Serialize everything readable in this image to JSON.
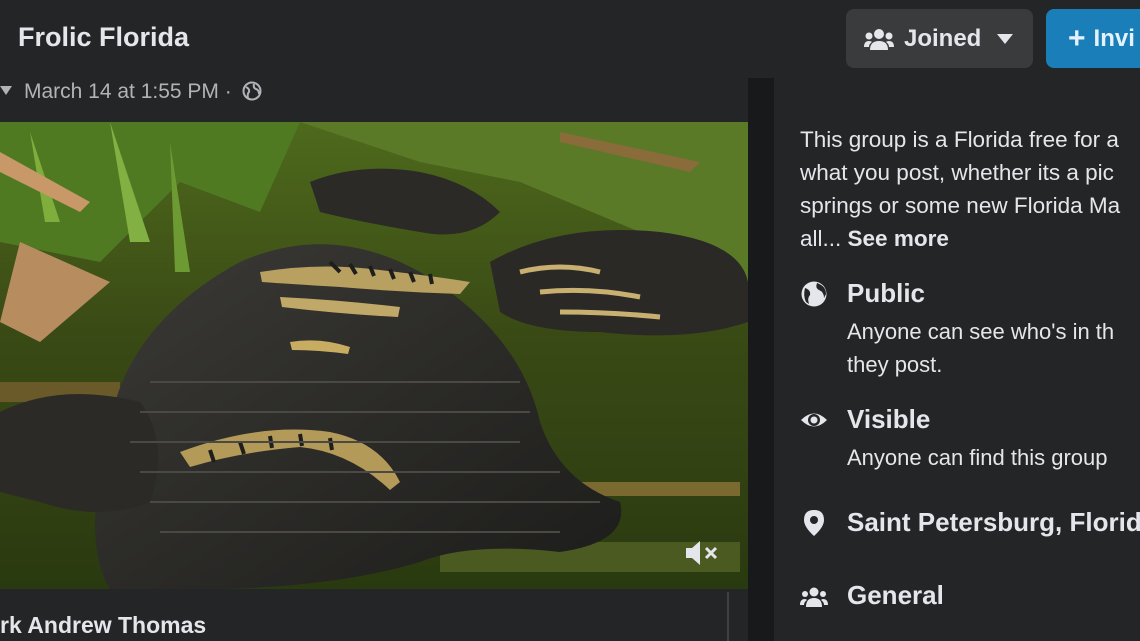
{
  "header": {
    "group_name": "Frolic Florida",
    "joined_label": "Joined",
    "invite_label": "Invi"
  },
  "post": {
    "meta": "March 14 at 1:55 PM ·",
    "commenter": "rk Andrew Thomas"
  },
  "about": {
    "description_lines": [
      "This group is a Florida free for a",
      "what you post, whether its a pic",
      "springs or some new Florida Ma",
      "all..."
    ],
    "see_more": "See more",
    "privacy": {
      "title": "Public",
      "sub_line1": "Anyone can see who's in th",
      "sub_line2": "they post."
    },
    "visibility": {
      "title": "Visible",
      "sub": "Anyone can find this group"
    },
    "location": {
      "title": "Saint Petersburg, Florid"
    },
    "category": {
      "title": "General"
    }
  },
  "icons": [
    "people-icon",
    "caret-down-icon",
    "plus-icon",
    "globe-icon",
    "mute-icon",
    "eye-icon",
    "location-pin-icon"
  ],
  "colors": {
    "accent": "#1a7fb8",
    "panel": "#242526",
    "background": "#18191a"
  }
}
